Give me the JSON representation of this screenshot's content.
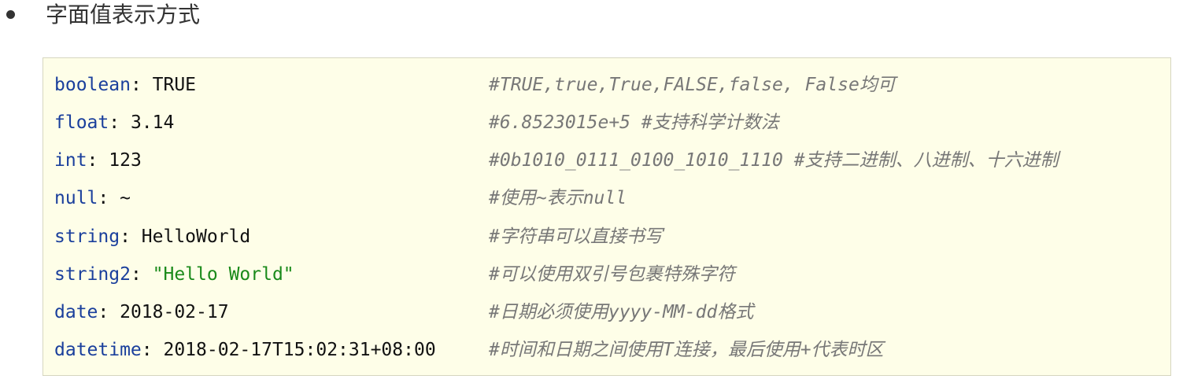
{
  "heading": "字面值表示方式",
  "code_lines": [
    {
      "key": "boolean",
      "value": "TRUE",
      "comment": "#TRUE,true,True,FALSE,false, False均可"
    },
    {
      "key": "float",
      "value": "3.14",
      "comment": "#6.8523015e+5  #支持科学计数法"
    },
    {
      "key": "int",
      "value": "123",
      "comment": "#0b1010_0111_0100_1010_1110    #支持二进制、八进制、十六进制"
    },
    {
      "key": "null",
      "value": "~",
      "comment": "#使用~表示null"
    },
    {
      "key": "string",
      "value": "HelloWorld",
      "comment": "#字符串可以直接书写"
    },
    {
      "key": "string2",
      "value": "\"Hello World\"",
      "comment": "#可以使用双引号包裹特殊字符"
    },
    {
      "key": "date",
      "value": "2018-02-17",
      "comment": "#日期必须使用yyyy-MM-dd格式"
    },
    {
      "key": "datetime",
      "value": "2018-02-17T15:02:31+08:00",
      "comment": "#时间和日期之间使用T连接，最后使用+代表时区"
    }
  ],
  "colors": {
    "key": "#1a3f9c",
    "string_value": "#1a8a1a",
    "comment": "#777777",
    "code_background": "#fefee8"
  }
}
